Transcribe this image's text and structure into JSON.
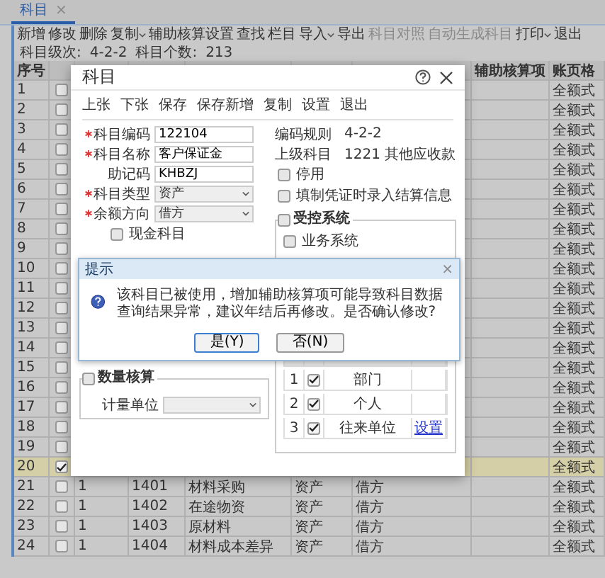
{
  "tabs": [
    {
      "label": "科目",
      "selected": true,
      "close": "×"
    }
  ],
  "toolbar": [
    {
      "label": "新增",
      "disabled": false,
      "dropdown": false
    },
    {
      "label": "修改",
      "disabled": false,
      "dropdown": false
    },
    {
      "label": "删除",
      "disabled": false,
      "dropdown": false
    },
    {
      "label": "复制",
      "disabled": false,
      "dropdown": true
    },
    {
      "label": "辅助核算设置",
      "disabled": false,
      "dropdown": false
    },
    {
      "label": "查找",
      "disabled": false,
      "dropdown": false
    },
    {
      "label": "栏目",
      "disabled": false,
      "dropdown": false
    },
    {
      "label": "导入",
      "disabled": false,
      "dropdown": true
    },
    {
      "label": "导出",
      "disabled": false,
      "dropdown": false
    },
    {
      "label": "科目对照",
      "disabled": true,
      "dropdown": false
    },
    {
      "label": "自动生成科目",
      "disabled": true,
      "dropdown": false
    },
    {
      "label": "打印",
      "disabled": false,
      "dropdown": true
    },
    {
      "label": "退出",
      "disabled": false,
      "dropdown": false
    }
  ],
  "summary": {
    "level_label": "科目级次:",
    "level_value": "4-2-2",
    "count_label": "科目个数:",
    "count_value": "213"
  },
  "table": {
    "columns": {
      "seq": "序号",
      "auxiliary": "辅助核算项",
      "page_format": "账页格"
    },
    "rows": [
      {
        "seq": "1",
        "checked": false,
        "selected": false,
        "page_format": "全额式"
      },
      {
        "seq": "2",
        "checked": false,
        "selected": false,
        "page_format": "全额式"
      },
      {
        "seq": "3",
        "checked": false,
        "selected": false,
        "page_format": "全额式"
      },
      {
        "seq": "4",
        "checked": false,
        "selected": false,
        "page_format": "全额式"
      },
      {
        "seq": "5",
        "checked": false,
        "selected": false,
        "page_format": "全额式"
      },
      {
        "seq": "6",
        "checked": false,
        "selected": false,
        "page_format": "全额式"
      },
      {
        "seq": "7",
        "checked": false,
        "selected": false,
        "page_format": "全额式"
      },
      {
        "seq": "8",
        "checked": false,
        "selected": false,
        "page_format": "全额式"
      },
      {
        "seq": "9",
        "checked": false,
        "selected": false,
        "page_format": "全额式"
      },
      {
        "seq": "10",
        "checked": false,
        "selected": false,
        "page_format": "全额式"
      },
      {
        "seq": "11",
        "checked": false,
        "selected": false,
        "page_format": "全额式"
      },
      {
        "seq": "12",
        "checked": false,
        "selected": false,
        "page_format": "全额式"
      },
      {
        "seq": "13",
        "checked": false,
        "selected": false,
        "page_format": "全额式"
      },
      {
        "seq": "14",
        "checked": false,
        "selected": false,
        "page_format": "全额式"
      },
      {
        "seq": "15",
        "checked": false,
        "selected": false,
        "page_format": "全额式"
      },
      {
        "seq": "16",
        "checked": false,
        "selected": false,
        "page_format": "全额式"
      },
      {
        "seq": "17",
        "checked": false,
        "selected": false,
        "page_format": "全额式"
      },
      {
        "seq": "18",
        "checked": false,
        "selected": false,
        "page_format": "全额式"
      },
      {
        "seq": "19",
        "checked": false,
        "selected": false,
        "page_format": "全额式"
      },
      {
        "seq": "20",
        "checked": true,
        "selected": true,
        "page_format": "全额式"
      },
      {
        "seq": "21",
        "checked": false,
        "selected": false,
        "level": "1",
        "code": "1401",
        "name": "材料采购",
        "type": "资产",
        "direction": "借方",
        "page_format": "全额式"
      },
      {
        "seq": "22",
        "checked": false,
        "selected": false,
        "level": "1",
        "code": "1402",
        "name": "在途物资",
        "type": "资产",
        "direction": "借方",
        "page_format": "全额式"
      },
      {
        "seq": "23",
        "checked": false,
        "selected": false,
        "level": "1",
        "code": "1403",
        "name": "原材料",
        "type": "资产",
        "direction": "借方",
        "page_format": "全额式"
      },
      {
        "seq": "24",
        "checked": false,
        "selected": false,
        "level": "1",
        "code": "1404",
        "name": "材料成本差异",
        "type": "资产",
        "direction": "借方",
        "page_format": "全额式"
      }
    ]
  },
  "dialog": {
    "title": "科目",
    "toolbar": [
      "上张",
      "下张",
      "保存",
      "保存新增",
      "复制",
      "设置",
      "退出"
    ],
    "fields": [
      {
        "label": "科目编码",
        "required": true,
        "kind": "text",
        "value": "122104"
      },
      {
        "label": "科目名称",
        "required": true,
        "kind": "text",
        "value": "客户保证金"
      },
      {
        "label": "助记码",
        "required": false,
        "kind": "text",
        "value": "KHBZJ"
      },
      {
        "label": "科目类型",
        "required": true,
        "kind": "select",
        "value": "资产"
      },
      {
        "label": "余额方向",
        "required": true,
        "kind": "select",
        "value": "借方"
      }
    ],
    "cash_account": {
      "label": "现金科目",
      "checked": false
    },
    "quantity": {
      "title": "数量核算",
      "checked": false,
      "unit_label": "计量单位"
    },
    "code_rule": {
      "label": "编码规则",
      "value": "4-2-2"
    },
    "parent": {
      "label": "上级科目",
      "value": "1221 其他应收款"
    },
    "options": [
      {
        "label": "停用",
        "checked": false
      },
      {
        "label": "填制凭证时录入结算信息",
        "checked": false
      }
    ],
    "controlled": {
      "title": "受控系统",
      "checked": false,
      "items": [
        {
          "label": "业务系统",
          "checked": false
        }
      ]
    },
    "aux_rows": [
      {
        "seq": "1",
        "checked": true,
        "name": "部门"
      },
      {
        "seq": "2",
        "checked": true,
        "name": "个人"
      },
      {
        "seq": "3",
        "checked": true,
        "name": "往来单位",
        "action": "设置"
      }
    ]
  },
  "message": {
    "title": "提示",
    "close": "×",
    "text": "该科目已被使用，增加辅助核算项可能导致科目数据查询结果异常，建议年结后再修改。是否确认修改?",
    "buttons": [
      {
        "label": "是(Y)",
        "selected": true
      },
      {
        "label": "否(N)",
        "selected": false
      }
    ]
  }
}
